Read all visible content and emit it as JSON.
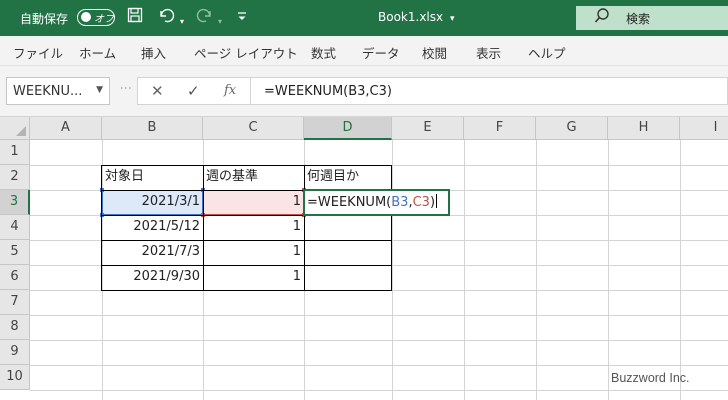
{
  "titlebar": {
    "autosave_label": "自動保存",
    "toggle_label": "オフ",
    "filename": "Book1.xlsx",
    "filename_caret": "▾",
    "search_label": "検索",
    "icons": [
      "save-icon",
      "undo-icon",
      "redo-icon",
      "customize-qat-icon",
      "search-icon"
    ]
  },
  "ribbon": {
    "tabs": [
      "ファイル",
      "ホーム",
      "挿入",
      "ページ レイアウト",
      "数式",
      "データ",
      "校閲",
      "表示",
      "ヘルプ"
    ]
  },
  "formula_bar": {
    "name_box": "WEEKNU...",
    "cancel_symbol": "✕",
    "enter_symbol": "✓",
    "fx_symbol": "fx",
    "formula": "=WEEKNUM(B3,C3)"
  },
  "grid": {
    "columns": [
      "A",
      "B",
      "C",
      "D",
      "E",
      "F",
      "G",
      "H",
      "I"
    ],
    "rows": [
      "1",
      "2",
      "3",
      "4",
      "5",
      "6",
      "7",
      "8",
      "9",
      "10"
    ],
    "selected_column": "D",
    "selected_row": "3"
  },
  "table": {
    "headers": [
      "対象日",
      "週の基準",
      "何週目か"
    ],
    "rows": [
      {
        "date": "2021/3/1",
        "basis": "1",
        "week": ""
      },
      {
        "date": "2021/5/12",
        "basis": "1",
        "week": ""
      },
      {
        "date": "2021/7/3",
        "basis": "1",
        "week": ""
      },
      {
        "date": "2021/9/30",
        "basis": "1",
        "week": ""
      }
    ],
    "editing_cell": {
      "prefix": "=WEEKNUM(",
      "ref1": "B3",
      "sep": ",",
      "ref2": "C3",
      "suffix": ")"
    }
  },
  "watermark": "Buzzword Inc.",
  "colors": {
    "accent": "#217346",
    "ref1": "#4472c4",
    "ref2": "#c0504d"
  }
}
